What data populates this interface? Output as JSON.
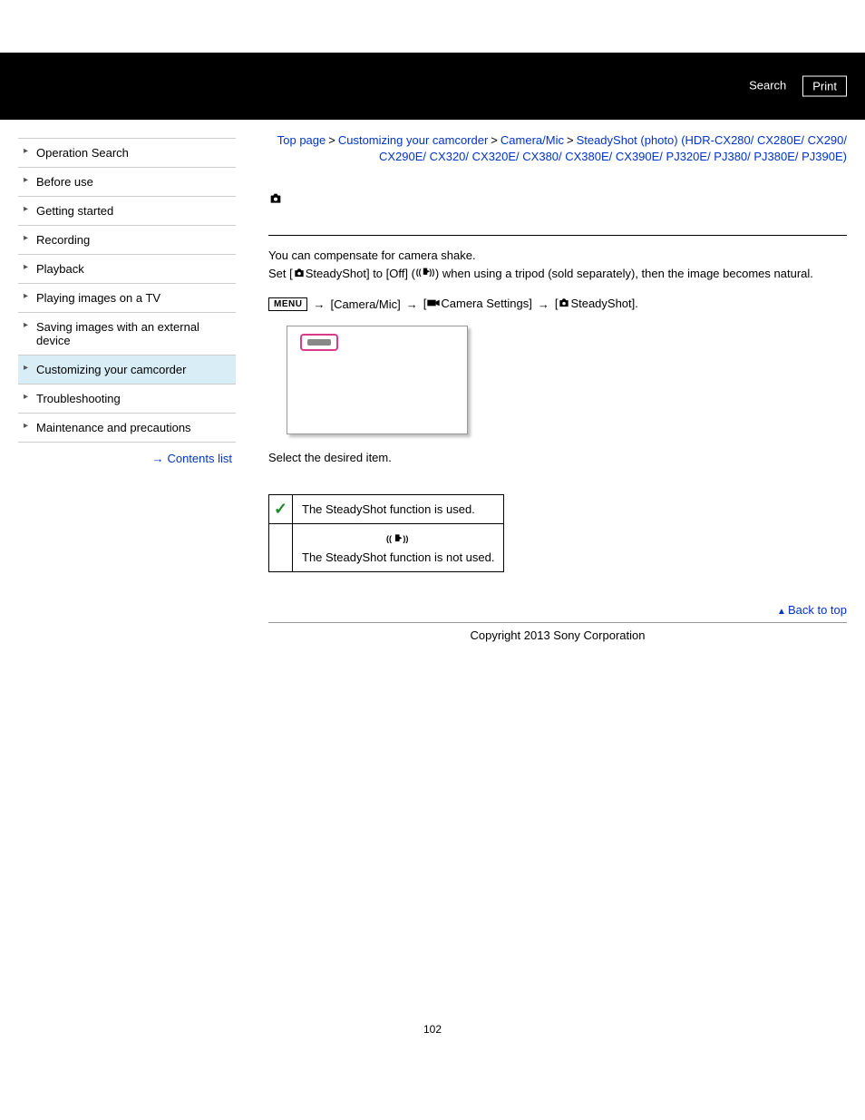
{
  "topbar": {
    "search": "Search",
    "print": "Print"
  },
  "sidebar": {
    "items": [
      "Operation Search",
      "Before use",
      "Getting started",
      "Recording",
      "Playback",
      "Playing images on a TV",
      "Saving images with an external device",
      "Customizing your camcorder",
      "Troubleshooting",
      "Maintenance and precautions"
    ],
    "contents_link": "Contents list"
  },
  "breadcrumb": {
    "top": "Top page",
    "l1": "Customizing your camcorder",
    "l2": "Camera/Mic",
    "leaf": "SteadyShot (photo) (HDR-CX280/ CX280E/ CX290/ CX290E/ CX320/ CX320E/ CX380/ CX380E/ CX390E/ PJ320E/ PJ380/ PJ380E/ PJ390E)"
  },
  "content": {
    "intro": "You can compensate for camera shake.",
    "set_pre": "Set [",
    "set_label": "SteadyShot] to [Off] (",
    "set_post": ") when using a tripod (sold separately), then the image becomes natural.",
    "path": {
      "menu": "MENU",
      "seg1_open": "[Camera/Mic]",
      "seg2_open": "[",
      "seg2_label": "Camera Settings]",
      "seg3_open": "[",
      "seg3_label": "SteadyShot]."
    },
    "step2": "Select the desired item.",
    "table": {
      "on_desc": "The SteadyShot function is used.",
      "off_desc": "The SteadyShot function is not used."
    }
  },
  "footer": {
    "backtop": "Back to top",
    "copyright": "Copyright 2013 Sony Corporation",
    "page": "102"
  }
}
